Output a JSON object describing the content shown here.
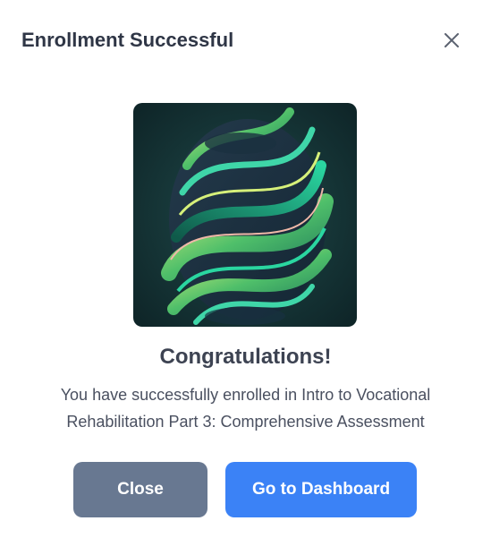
{
  "dialog": {
    "title": "Enrollment Successful",
    "close_icon": "close-icon"
  },
  "content": {
    "image": "abstract-swirl-image",
    "headline": "Congratulations!",
    "message": "You have successfully enrolled in Intro to Vocational Rehabilitation Part 3: Comprehensive Assessment"
  },
  "actions": {
    "close_label": "Close",
    "dashboard_label": "Go to Dashboard"
  },
  "colors": {
    "primary": "#3b82f6",
    "secondary": "#687891",
    "title_text": "#2f3646"
  }
}
